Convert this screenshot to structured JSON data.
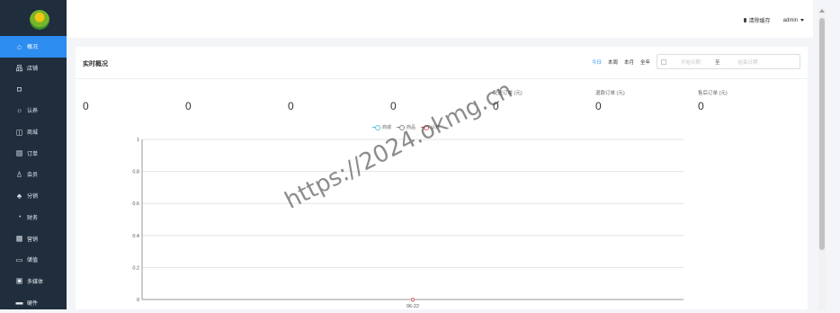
{
  "sidebar": {
    "items": [
      {
        "icon": "home-icon",
        "glyph": "⌂",
        "label": "概况",
        "active": true
      },
      {
        "icon": "shop-icon",
        "glyph": "品",
        "label": "店铺",
        "active": false
      },
      {
        "icon": "box-icon",
        "glyph": "◘",
        "label": "",
        "active": false
      },
      {
        "icon": "circle-icon",
        "glyph": "○",
        "label": "认养",
        "active": false
      },
      {
        "icon": "store-icon",
        "glyph": "◫",
        "label": "商城",
        "active": false
      },
      {
        "icon": "order-icon",
        "glyph": "▤",
        "label": "订单",
        "active": false
      },
      {
        "icon": "user-icon",
        "glyph": "♙",
        "label": "会员",
        "active": false
      },
      {
        "icon": "tree-icon",
        "glyph": "♣",
        "label": "分销",
        "active": false
      },
      {
        "icon": "pie-icon",
        "glyph": "◔",
        "label": "财务",
        "active": false
      },
      {
        "icon": "ad-icon",
        "glyph": "▦",
        "label": "营销",
        "active": false
      },
      {
        "icon": "device-icon",
        "glyph": "▭",
        "label": "储值",
        "active": false
      },
      {
        "icon": "media-icon",
        "glyph": "▣",
        "label": "多媒体",
        "active": false
      },
      {
        "icon": "hardware-icon",
        "glyph": "▬",
        "label": "硬件",
        "active": false
      }
    ]
  },
  "topbar": {
    "clear_cache": "清除缓存",
    "user": "admin"
  },
  "card": {
    "title": "实时概况",
    "filters": {
      "tabs": [
        {
          "label": "今日",
          "active": true
        },
        {
          "label": "本周",
          "active": false
        },
        {
          "label": "本月",
          "active": false
        },
        {
          "label": "全年",
          "active": false
        }
      ],
      "start_placeholder": "开始日期",
      "separator": "至",
      "end_placeholder": "结束日期"
    },
    "stats": [
      {
        "label": "",
        "value": "0"
      },
      {
        "label": "",
        "value": "0"
      },
      {
        "label": "",
        "value": "0"
      },
      {
        "label": "",
        "value": "0"
      },
      {
        "label": "配送订单 (元)",
        "value": "0"
      },
      {
        "label": "退款订单 (元)",
        "value": "0"
      },
      {
        "label": "售后订单 (元)",
        "value": "0"
      }
    ]
  },
  "watermark": "https://2024.okmg.cn",
  "chart_data": {
    "type": "line",
    "x": [
      "06-22"
    ],
    "series": [
      {
        "name": "商城",
        "values": [
          0
        ],
        "color": "#5bc0de"
      },
      {
        "name": "商品",
        "values": [
          0
        ],
        "color": "#888888"
      },
      {
        "name": "认养",
        "values": [
          0
        ],
        "color": "#e55a6a"
      }
    ],
    "yticks": [
      "0",
      "0.2",
      "0.4",
      "0.6",
      "0.8",
      "1"
    ],
    "ylim": [
      0,
      1
    ],
    "grid": true,
    "legend": "top-center"
  }
}
